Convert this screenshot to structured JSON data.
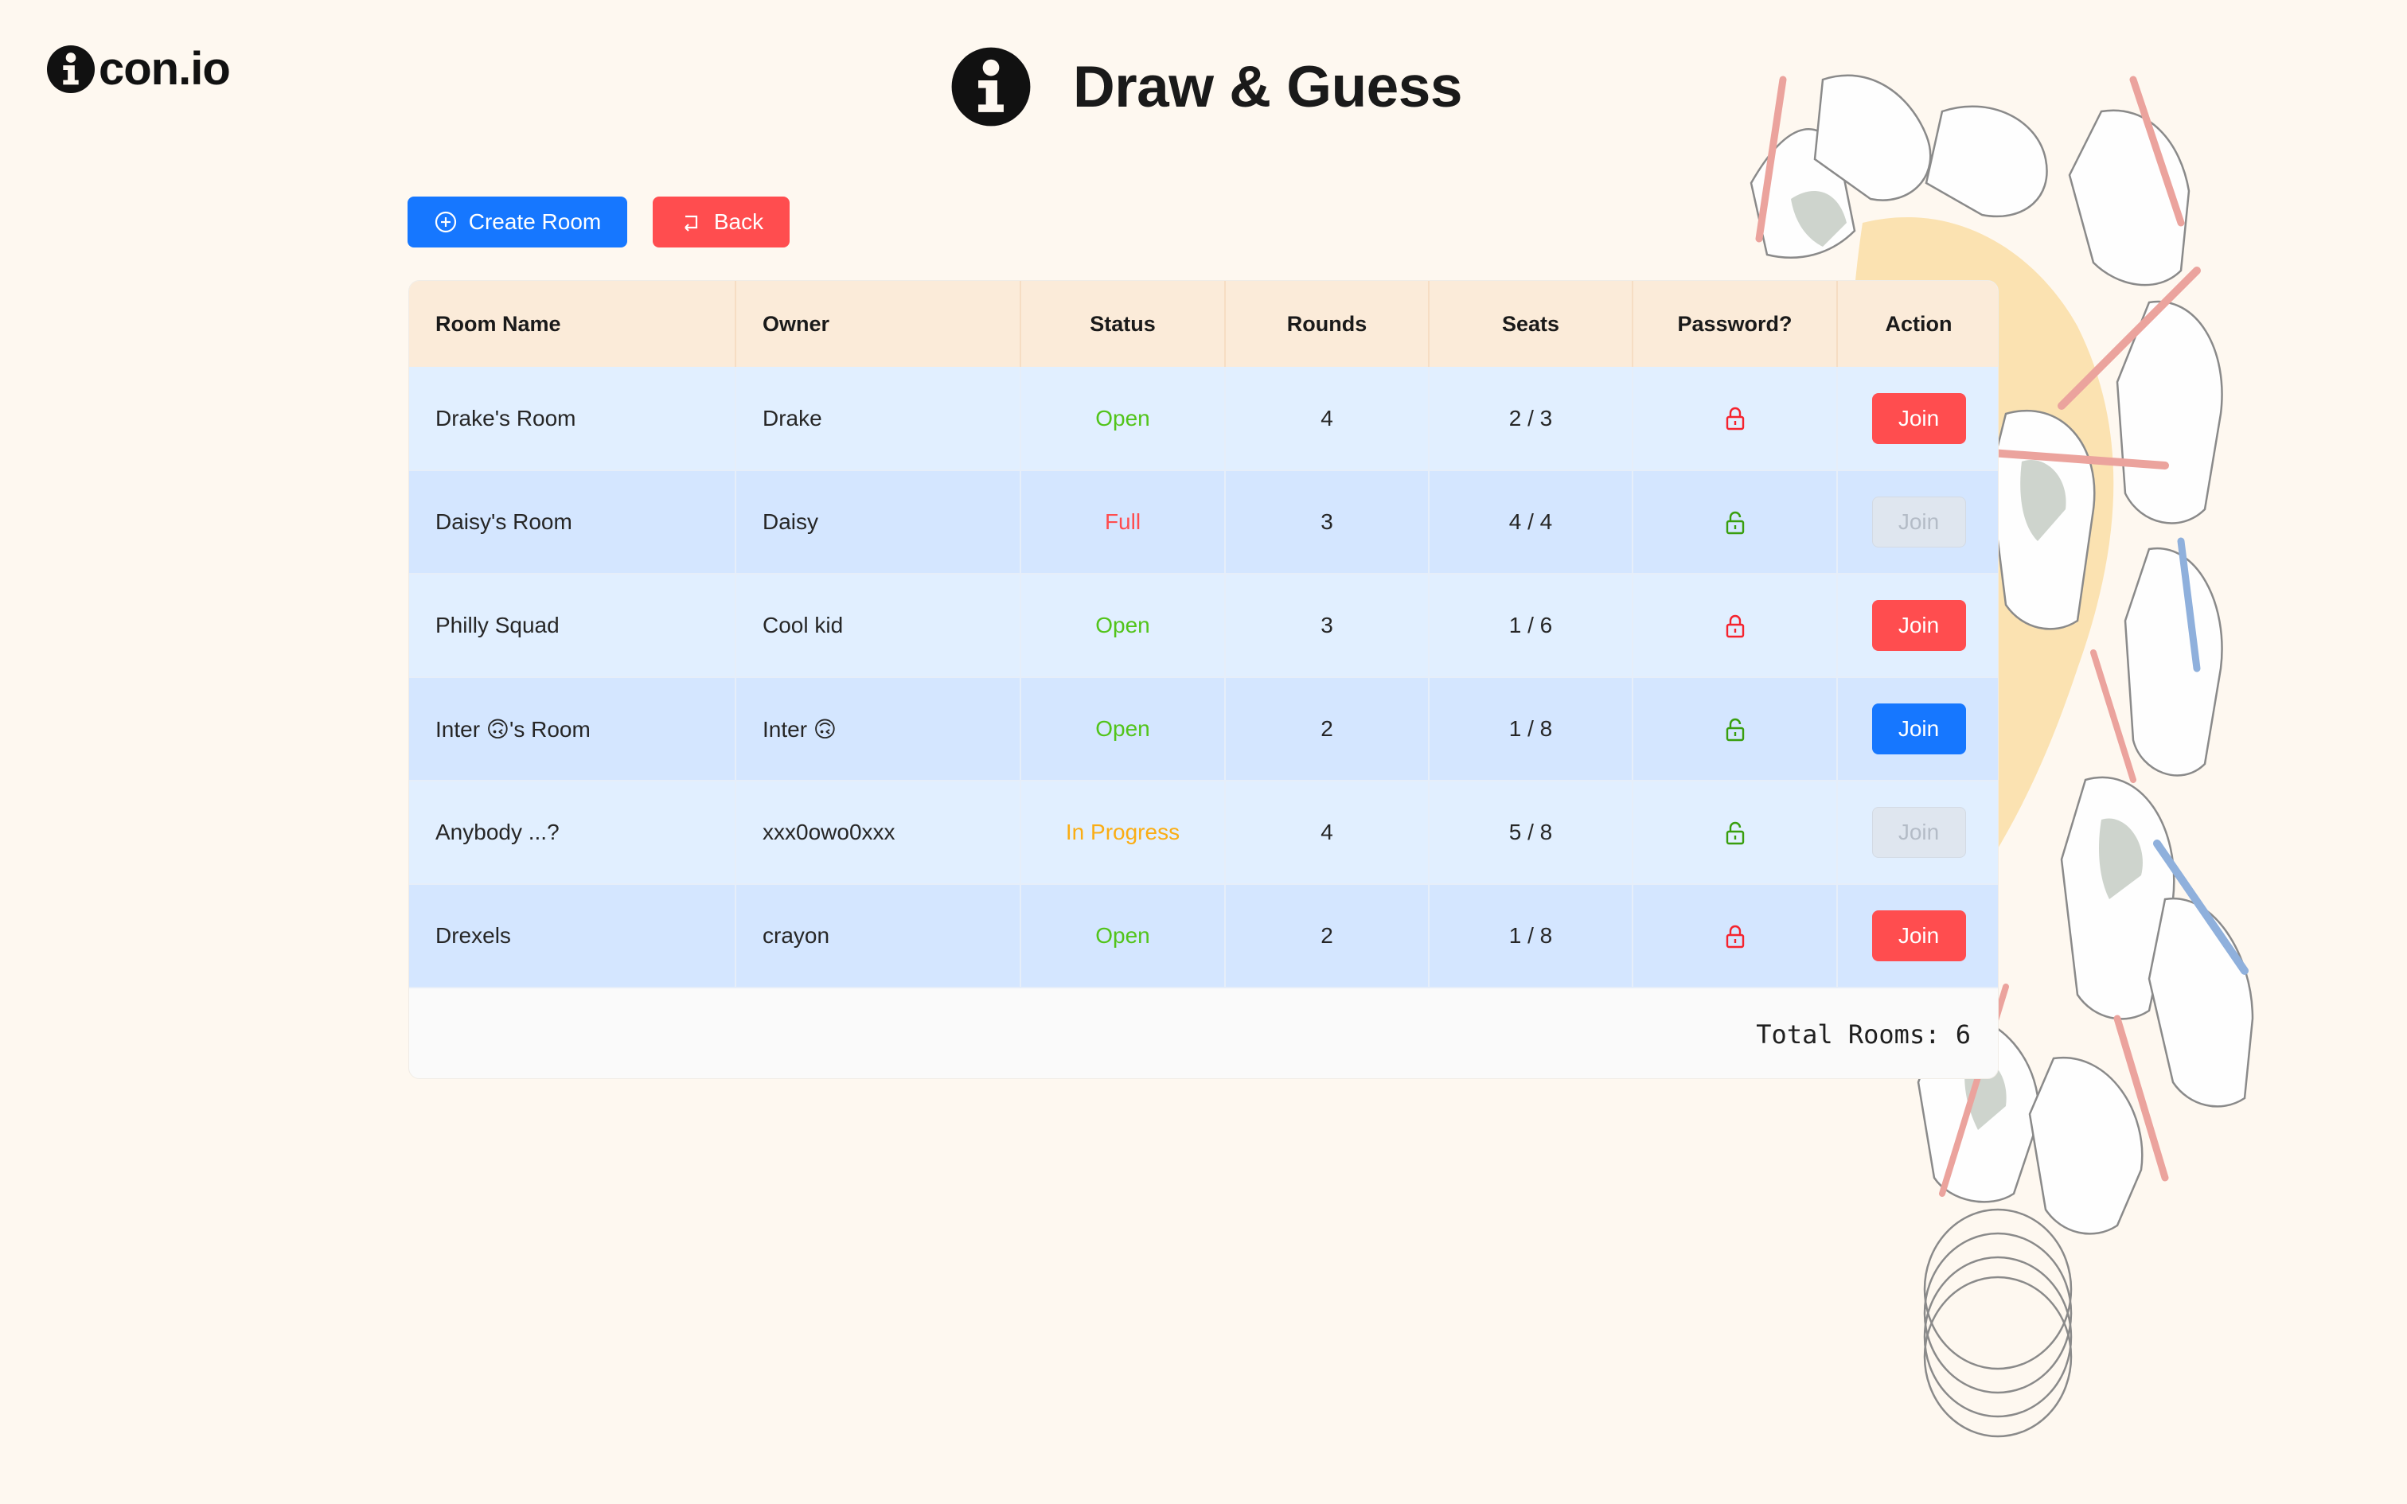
{
  "brand": {
    "logo_text": "con.io"
  },
  "header": {
    "title": "Draw & Guess"
  },
  "toolbar": {
    "create_label": "Create Room",
    "back_label": "Back"
  },
  "table": {
    "columns": [
      "Room Name",
      "Owner",
      "Status",
      "Rounds",
      "Seats",
      "Password?",
      "Action"
    ],
    "rows": [
      {
        "name": "Drake's Room",
        "owner": "Drake",
        "status": "Open",
        "rounds": "4",
        "seats": "2 / 3",
        "password": "locked",
        "join": "Join"
      },
      {
        "name": "Daisy's Room",
        "owner": "Daisy",
        "status": "Full",
        "rounds": "3",
        "seats": "4 / 4",
        "password": "unlocked",
        "join": "Join"
      },
      {
        "name": "Philly Squad",
        "owner": "Cool kid",
        "status": "Open",
        "rounds": "3",
        "seats": "1 / 6",
        "password": "locked",
        "join": "Join"
      },
      {
        "name": "Inter 🙃's Room",
        "owner": "Inter 🙃",
        "status": "Open",
        "rounds": "2",
        "seats": "1 / 8",
        "password": "unlocked",
        "join": "Join"
      },
      {
        "name": "Anybody ...?",
        "owner": "xxx0owo0xxx",
        "status": "In Progress",
        "rounds": "4",
        "seats": "5 / 8",
        "password": "unlocked",
        "join": "Join"
      },
      {
        "name": "Drexels",
        "owner": "crayon",
        "status": "Open",
        "rounds": "2",
        "seats": "1 / 8",
        "password": "locked",
        "join": "Join"
      }
    ],
    "footer": "Total Rooms: 6"
  },
  "colors": {
    "background": "#fef8f0",
    "primary": "#1677ff",
    "danger": "#ff4d4f",
    "open": "#52c41a",
    "progress": "#faad14",
    "header_row": "#fbebd9"
  },
  "icons": {
    "logo": "info-icon",
    "create": "plus-circle-icon",
    "back": "rollback-icon",
    "locked": "lock-icon",
    "unlocked": "unlock-icon"
  }
}
